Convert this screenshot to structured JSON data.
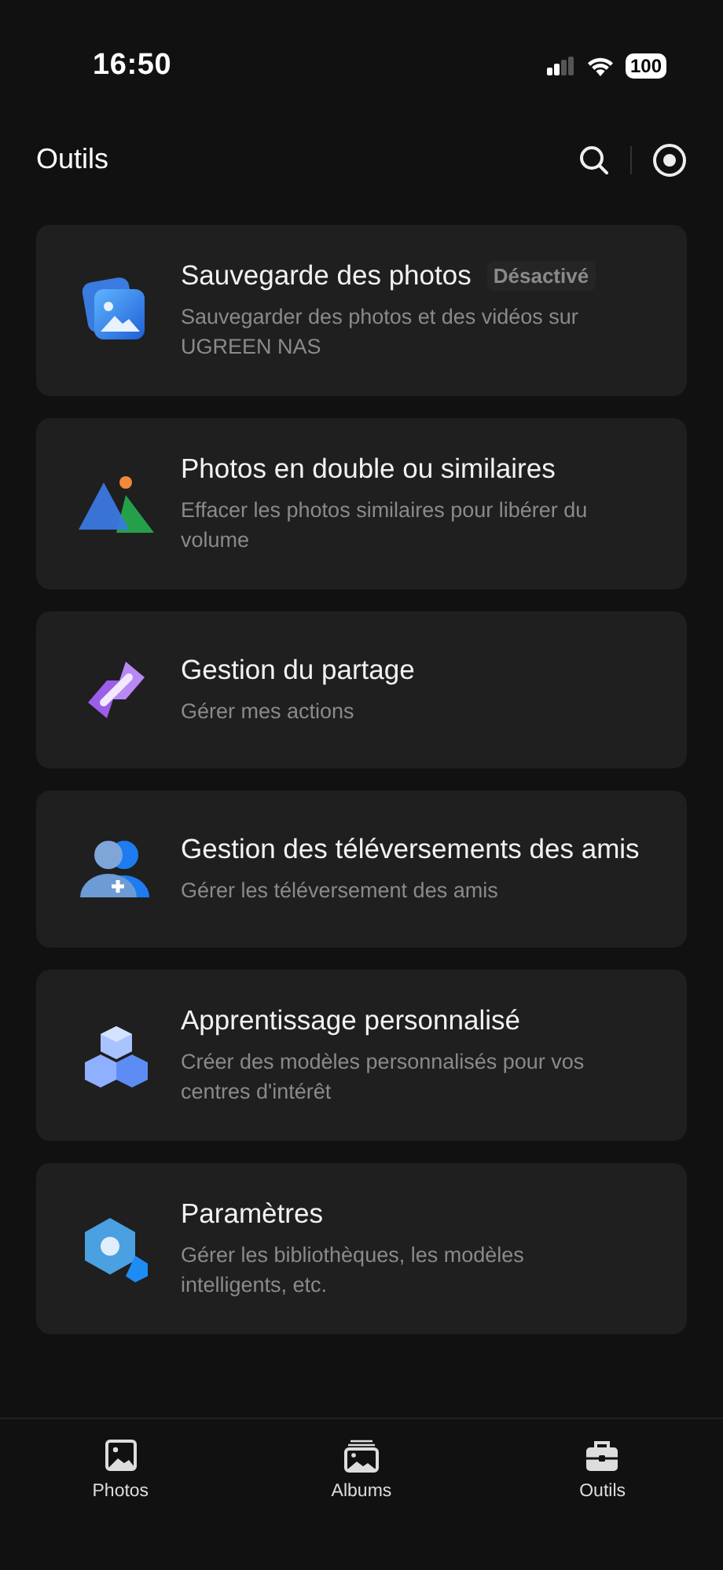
{
  "status_bar": {
    "time": "16:50",
    "battery": "100"
  },
  "header": {
    "title": "Outils"
  },
  "tools": [
    {
      "title": "Sauvegarde des photos",
      "badge": "Désactivé",
      "subtitle": "Sauvegarder des photos et des vidéos sur UGREEN NAS"
    },
    {
      "title": "Photos en double ou similaires",
      "subtitle": "Effacer les photos similaires pour libérer du volume"
    },
    {
      "title": "Gestion du partage",
      "subtitle": "Gérer mes actions"
    },
    {
      "title": "Gestion des téléversements des amis",
      "subtitle": "Gérer les téléversement des amis"
    },
    {
      "title": "Apprentissage personnalisé",
      "subtitle": "Créer des modèles personnalisés pour vos centres d'intérêt"
    },
    {
      "title": "Paramètres",
      "subtitle": "Gérer les bibliothèques, les modèles intelligents, etc."
    }
  ],
  "tab_bar": [
    {
      "label": "Photos"
    },
    {
      "label": "Albums"
    },
    {
      "label": "Outils"
    }
  ]
}
